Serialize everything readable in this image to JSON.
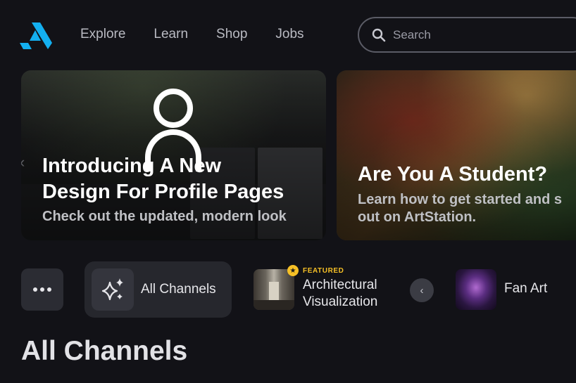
{
  "header": {
    "logo_icon": "artstation-logo-icon",
    "nav": [
      "Explore",
      "Learn",
      "Shop",
      "Jobs"
    ],
    "search": {
      "placeholder": "Search",
      "icon": "search-icon"
    }
  },
  "banners": [
    {
      "title_line1": "Introducing A New",
      "title_line2": "Design For Profile Pages",
      "subtitle": "Check out the updated, modern look"
    },
    {
      "title": "Are You A Student?",
      "subtitle_line1": "Learn how to get started and s",
      "subtitle_line2": "out on ArtStation."
    }
  ],
  "channels": {
    "more_icon": "more-dots-icon",
    "all": {
      "label": "All Channels",
      "icon": "sparkle-icon"
    },
    "architectural": {
      "badge": "FEATURED",
      "line1": "Architectural",
      "line2": "Visualization",
      "badge_icon": "star-icon"
    },
    "prev_icon": "chevron-left-icon",
    "fan_art": {
      "label": "Fan Art"
    }
  },
  "section_title": "All Channels",
  "colors": {
    "background": "#121217",
    "brand": "#13AFF0",
    "featured": "#F6C026"
  }
}
